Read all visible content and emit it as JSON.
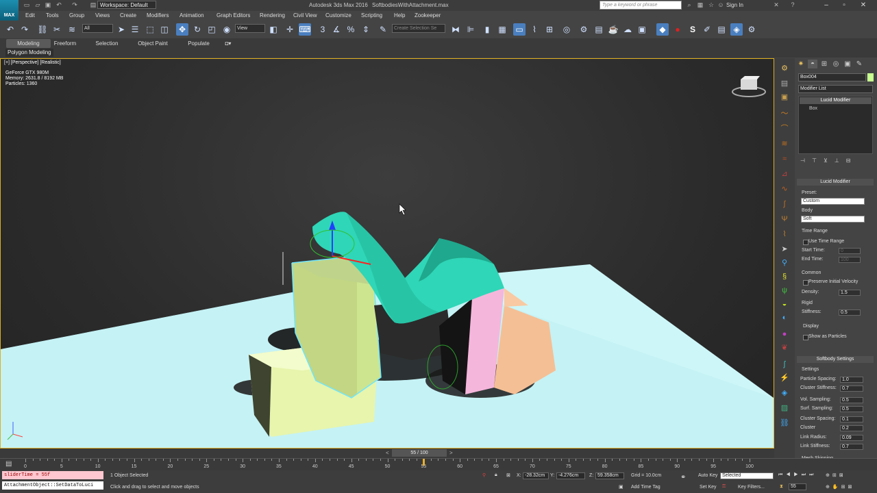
{
  "title_bar": {
    "workspace": "Workspace: Default",
    "app": "Autodesk 3ds Max 2016",
    "file": "SoftbodiesWithAttachment.max",
    "search_placeholder": "Type a keyword or phrase",
    "sign_in": "Sign In"
  },
  "logo": "MAX",
  "menu": [
    "Edit",
    "Tools",
    "Group",
    "Views",
    "Create",
    "Modifiers",
    "Animation",
    "Graph Editors",
    "Rendering",
    "Civil View",
    "Customize",
    "Scripting",
    "Help",
    "Zookeeper"
  ],
  "toolbar": {
    "filter": "All",
    "ref_coord": "View",
    "named_sel": "Create Selection Se"
  },
  "ribbon": {
    "tabs": [
      "Modeling",
      "Freeform",
      "Selection",
      "Object Paint",
      "Populate"
    ],
    "active_tab": "Modeling",
    "sub": "Polygon Modeling"
  },
  "viewport": {
    "label": "[+] [Perspective] [Realistic]",
    "gpu": "GeForce GTX 980M",
    "memory": "Memory: 2631.8 / 8192 MB",
    "particles": "Particles: 1360"
  },
  "command_panel": {
    "object_name": "Box004",
    "object_color": "#c8ff90",
    "modifier_list": "Modifier List",
    "stack": [
      "Lucid Modifier",
      "Box"
    ],
    "rollout_lucid": "Lucid Modifier",
    "preset_label": "Preset:",
    "preset_value": "Custom",
    "body_label": "Body",
    "body_value": "Soft",
    "time_range": "Time Range",
    "use_time_range": "Use Time Range",
    "start_time": "Start Time:",
    "start_time_val": "0",
    "end_time": "End Time:",
    "end_time_val": "100",
    "common": "Common",
    "preserve_velocity": "Preserve Initial Velocity",
    "density": "Density:",
    "density_val": "1.5",
    "rigid": "Rigid",
    "stiffness": "Stiffness:",
    "stiffness_val": "0.5",
    "display": "Display",
    "show_particles": "Show as Particles",
    "rollout_softbody": "Softbody Settings",
    "settings": "Settings",
    "params": [
      {
        "label": "Particle Spacing:",
        "value": "1.0"
      },
      {
        "label": "Cluster Stiffness:",
        "value": "0.7"
      },
      {
        "label": "Vol. Sampling:",
        "value": "0.5"
      },
      {
        "label": "Surf. Sampling:",
        "value": "0.5"
      },
      {
        "label": "Cluster Spacing:",
        "value": "0.1"
      },
      {
        "label": "Cluster",
        "value": "0.2"
      },
      {
        "label": "Link Radius:",
        "value": "0.09"
      },
      {
        "label": "Link Stiffness:",
        "value": "0.7"
      }
    ],
    "mesh_skinning": "Mesh Skinning"
  },
  "timeline": {
    "frame": "55 / 100",
    "current": 55,
    "max": 100,
    "labels": [
      "0",
      "5",
      "10",
      "15",
      "20",
      "25",
      "30",
      "35",
      "40",
      "45",
      "50",
      "55",
      "60",
      "65",
      "70",
      "75",
      "80",
      "85",
      "90",
      "95",
      "100"
    ]
  },
  "status": {
    "listener1": "sliderTime = 55f",
    "listener2": "AttachmentObject::SetDataToLuci",
    "selected": "1 Object Selected",
    "prompt": "Click and drag to select and move objects",
    "x": "-28.32cm",
    "y": "-4.276cm",
    "z": "59.358cm",
    "grid": "Grid = 10.0cm",
    "add_time_tag": "Add Time Tag",
    "auto_key": "Auto Key",
    "selected_set": "Selected",
    "set_key": "Set Key",
    "key_filters": "Key Filters...",
    "frame_field": "55"
  }
}
